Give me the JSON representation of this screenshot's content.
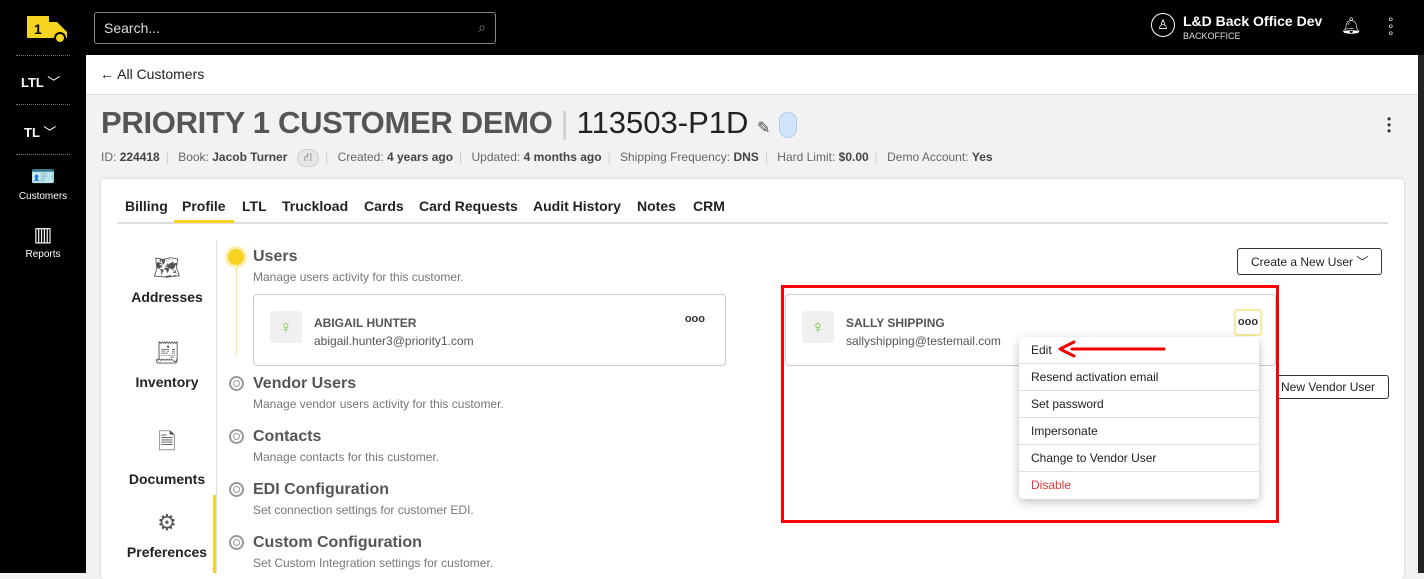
{
  "topbar": {
    "search_placeholder": "Search...",
    "user_name": "L&D Back Office Dev",
    "user_role": "BACKOFFICE"
  },
  "sidebar": {
    "items": [
      {
        "label": "LTL"
      },
      {
        "label": "TL"
      },
      {
        "label": "Customers"
      },
      {
        "label": "Reports"
      }
    ]
  },
  "breadcrumb": {
    "back_label": "All Customers"
  },
  "customer": {
    "name": "PRIORITY 1 CUSTOMER DEMO",
    "code": "113503-P1D",
    "meta": {
      "id_label": "ID:",
      "id": "224418",
      "book_label": "Book:",
      "book": "Jacob Turner",
      "created_label": "Created:",
      "created": "4 years ago",
      "updated_label": "Updated:",
      "updated": "4 months ago",
      "freq_label": "Shipping Frequency:",
      "freq": "DNS",
      "limit_label": "Hard Limit:",
      "limit": "$0.00",
      "demo_label": "Demo Account:",
      "demo": "Yes"
    }
  },
  "tabs": [
    {
      "label": "Billing"
    },
    {
      "label": "Profile",
      "active": true
    },
    {
      "label": "LTL"
    },
    {
      "label": "Truckload"
    },
    {
      "label": "Cards"
    },
    {
      "label": "Card Requests"
    },
    {
      "label": "Audit History"
    },
    {
      "label": "Notes"
    },
    {
      "label": "CRM"
    }
  ],
  "left_nav": [
    {
      "label": "Addresses"
    },
    {
      "label": "Inventory"
    },
    {
      "label": "Documents"
    },
    {
      "label": "Preferences",
      "active": true
    }
  ],
  "sections": [
    {
      "title": "Users",
      "desc": "Manage users activity for this customer."
    },
    {
      "title": "Vendor Users",
      "desc": "Manage vendor users activity for this customer."
    },
    {
      "title": "Contacts",
      "desc": "Manage contacts for this customer."
    },
    {
      "title": "EDI Configuration",
      "desc": "Set connection settings for customer EDI."
    },
    {
      "title": "Custom Configuration",
      "desc": "Set Custom Integration settings for customer."
    }
  ],
  "buttons": {
    "create_user": "Create a New User",
    "new_vendor_user": "New Vendor User"
  },
  "users": [
    {
      "name": "ABIGAIL HUNTER",
      "email": "abigail.hunter3@priority1.com"
    },
    {
      "name": "SALLY SHIPPING",
      "email": "sallyshipping@testemail.com"
    }
  ],
  "menu": {
    "items": [
      {
        "label": "Edit"
      },
      {
        "label": "Resend activation email"
      },
      {
        "label": "Set password"
      },
      {
        "label": "Impersonate"
      },
      {
        "label": "Change to Vendor User"
      },
      {
        "label": "Disable"
      }
    ]
  },
  "colors": {
    "accent": "#f5d320",
    "highlight": "#ff0000",
    "danger": "#e03b3b"
  }
}
